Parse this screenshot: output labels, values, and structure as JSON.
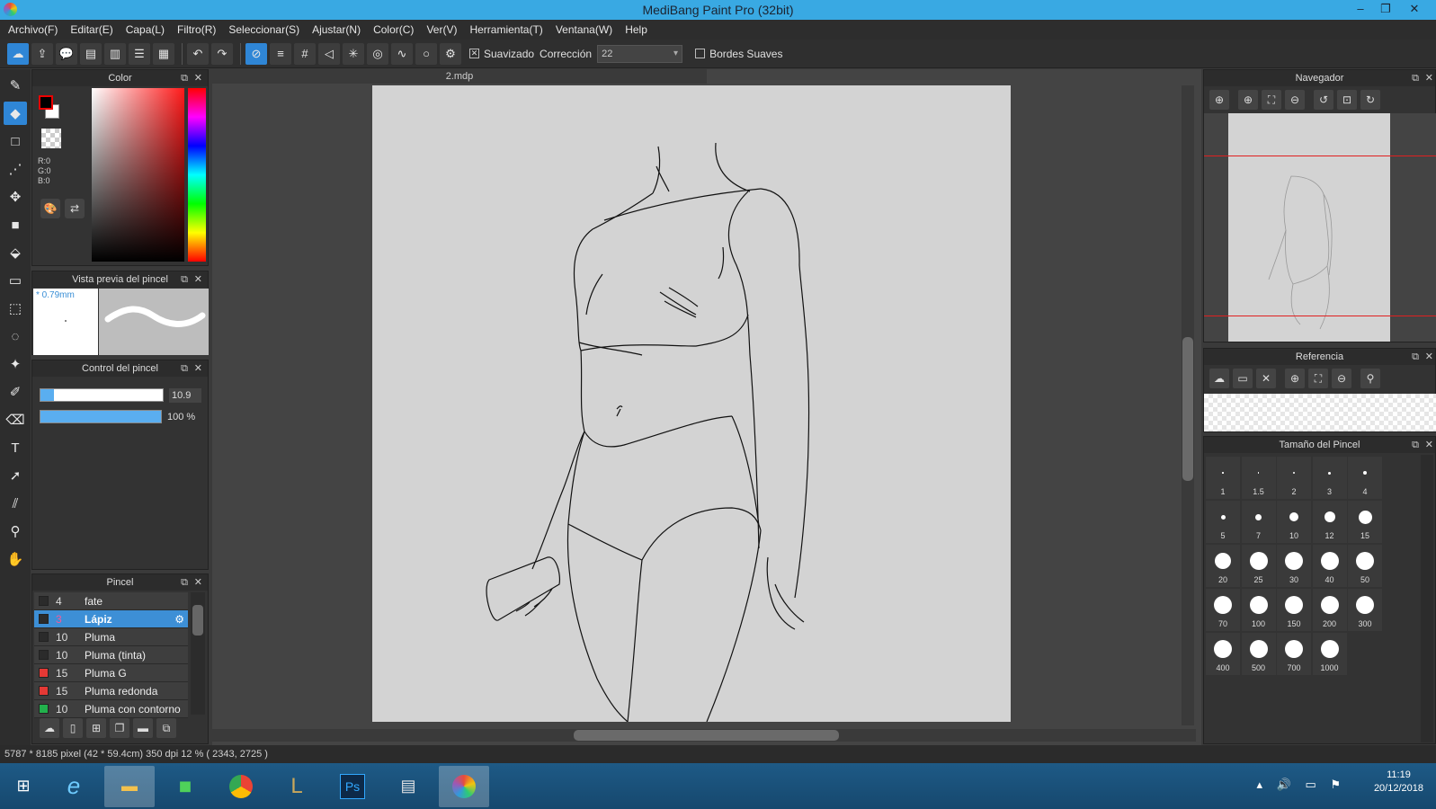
{
  "window": {
    "title": "MediBang Paint Pro (32bit)",
    "min": "–",
    "restore": "❐",
    "close": "✕"
  },
  "menu": [
    "Archivo(F)",
    "Editar(E)",
    "Capa(L)",
    "Filtro(R)",
    "Seleccionar(S)",
    "Ajustar(N)",
    "Color(C)",
    "Ver(V)",
    "Herramienta(T)",
    "Ventana(W)",
    "Help"
  ],
  "toolbar": {
    "smoothing_label": "Suavizado",
    "correction_label": "Corrección",
    "correction_value": "22",
    "soft_edges_label": "Bordes Suaves",
    "smoothing_checked": "✕"
  },
  "document": {
    "tab": "2.mdp"
  },
  "color_panel": {
    "title": "Color",
    "r": "R:0",
    "g": "G:0",
    "b": "B:0",
    "primary": "#000000",
    "secondary": "#ffffff"
  },
  "brush_preview": {
    "title": "Vista previa del pincel",
    "size": "* 0.79mm"
  },
  "brush_control": {
    "title": "Control del pincel",
    "size_value": "10.9",
    "opacity_value": "100 %",
    "size_fraction": 0.109,
    "opacity_fraction": 1.0
  },
  "brush_panel": {
    "title": "Pincel",
    "items": [
      {
        "num": "4",
        "name": "fate",
        "color": "#2b2b2b"
      },
      {
        "num": "3",
        "name": "Lápiz",
        "color": "#2b2b2b"
      },
      {
        "num": "10",
        "name": "Pluma",
        "color": "#2b2b2b"
      },
      {
        "num": "10",
        "name": "Pluma (tinta)",
        "color": "#2b2b2b"
      },
      {
        "num": "15",
        "name": "Pluma G",
        "color": "#e53935"
      },
      {
        "num": "15",
        "name": "Pluma redonda",
        "color": "#e53935"
      },
      {
        "num": "10",
        "name": "Pluma con contorno",
        "color": "#22b14c"
      }
    ]
  },
  "navigator": {
    "title": "Navegador"
  },
  "reference": {
    "title": "Referencia"
  },
  "brush_size": {
    "title": "Tamaño del Pincel",
    "sizes": [
      "1",
      "1.5",
      "2",
      "3",
      "4",
      "5",
      "7",
      "10",
      "12",
      "15",
      "20",
      "25",
      "30",
      "40",
      "50",
      "70",
      "100",
      "150",
      "200",
      "300",
      "400",
      "500",
      "700",
      "1000"
    ]
  },
  "status": {
    "text": "5787 * 8185 pixel   (42 * 59.4cm)   350 dpi   12 %   ( 2343, 2725 )"
  },
  "taskbar": {
    "time": "11:19",
    "date": "20/12/2018",
    "ps_label": "Ps"
  },
  "colors": {
    "accent": "#2f86d6",
    "titlebar": "#39a9e3"
  }
}
